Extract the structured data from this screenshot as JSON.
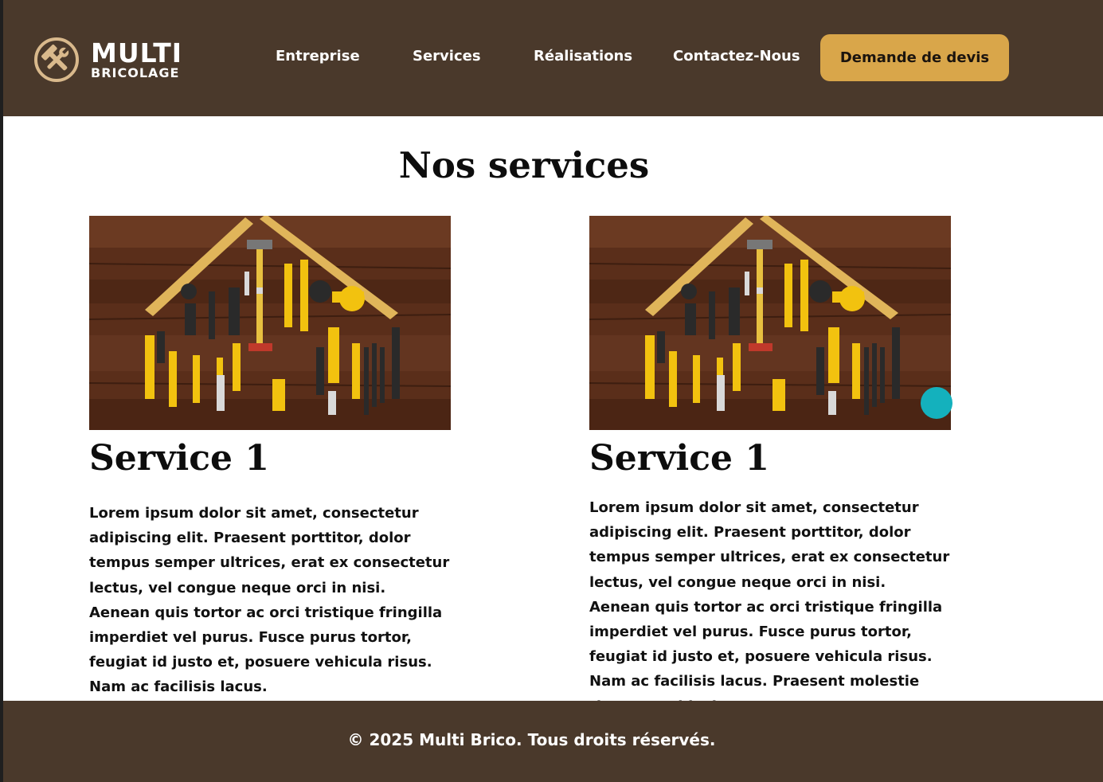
{
  "brand": {
    "line1": "MULTI",
    "line2": "BRICOLAGE",
    "icon": "hammer-wrench-icon",
    "accent_color": "#d9a64a",
    "header_color": "#4a392b"
  },
  "nav": {
    "items": [
      {
        "label": "Entreprise"
      },
      {
        "label": "Services"
      },
      {
        "label": "Réalisations"
      },
      {
        "label": "Contactez-Nous"
      }
    ],
    "cta_label": "Demande de devis"
  },
  "main": {
    "title": "Nos services",
    "cards": [
      {
        "image": "tools-house-photo",
        "title": "Service 1",
        "text": "Lorem ipsum dolor sit amet, consectetur adipiscing elit. Praesent porttitor, dolor tempus semper ultrices, erat ex consectetur lectus, vel congue neque orci in nisi. Aenean quis tortor ac orci tristique fringilla imperdiet vel purus. Fusce purus tortor, feugiat id justo et, posuere vehicula risus. Nam ac facilisis lacus."
      },
      {
        "image": "tools-house-photo",
        "title": "Service 1",
        "text": "Lorem ipsum dolor sit amet, consectetur adipiscing elit. Praesent porttitor, dolor tempus semper ultrices, erat ex consectetur lectus, vel congue neque orci in nisi. Aenean quis tortor ac orci tristique fringilla imperdiet vel purus. Fusce purus tortor, feugiat id justo et, posuere vehicula risus. Nam ac facilisis lacus. Praesent molestie rhoncus vehicula."
      }
    ]
  },
  "footer": {
    "text": "© 2025 Multi Brico. Tous droits réservés."
  }
}
